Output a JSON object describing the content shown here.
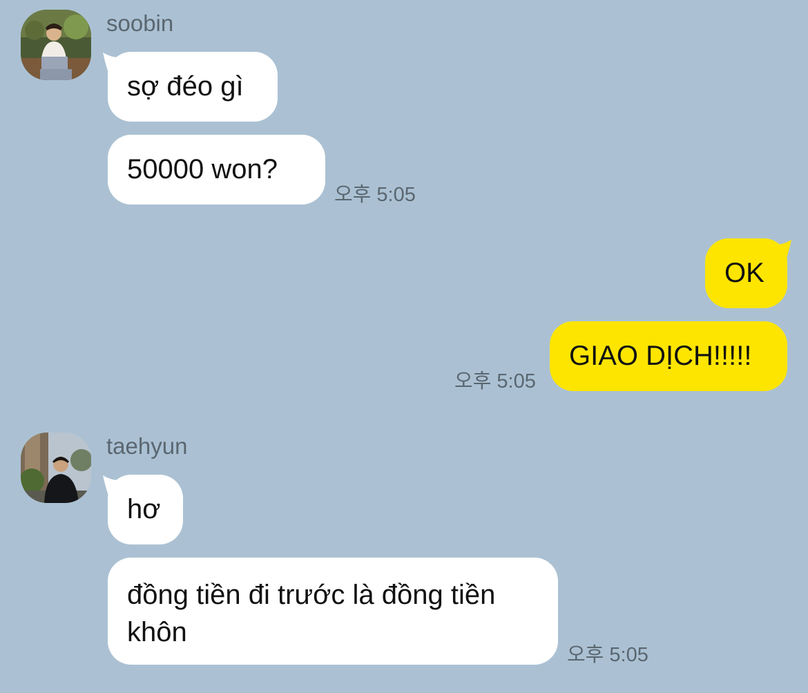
{
  "conversation": {
    "group1": {
      "sender": "soobin",
      "avatar_icon": "user-photo-icon",
      "messages": [
        "sợ đéo gì",
        "50000 won?"
      ],
      "time": "오후 5:05"
    },
    "group2": {
      "messages": [
        "OK",
        "GIAO DỊCH!!!!!"
      ],
      "time": "오후 5:05"
    },
    "group3": {
      "sender": "taehyun",
      "avatar_icon": "user-photo-icon",
      "messages": [
        "hơ",
        "đồng tiền đi trước là đồng tiền khôn"
      ],
      "time": "오후 5:05"
    }
  },
  "colors": {
    "background": "#abc1d3",
    "incoming_bubble": "#ffffff",
    "outgoing_bubble": "#fee500",
    "meta_text": "#5a6670"
  }
}
